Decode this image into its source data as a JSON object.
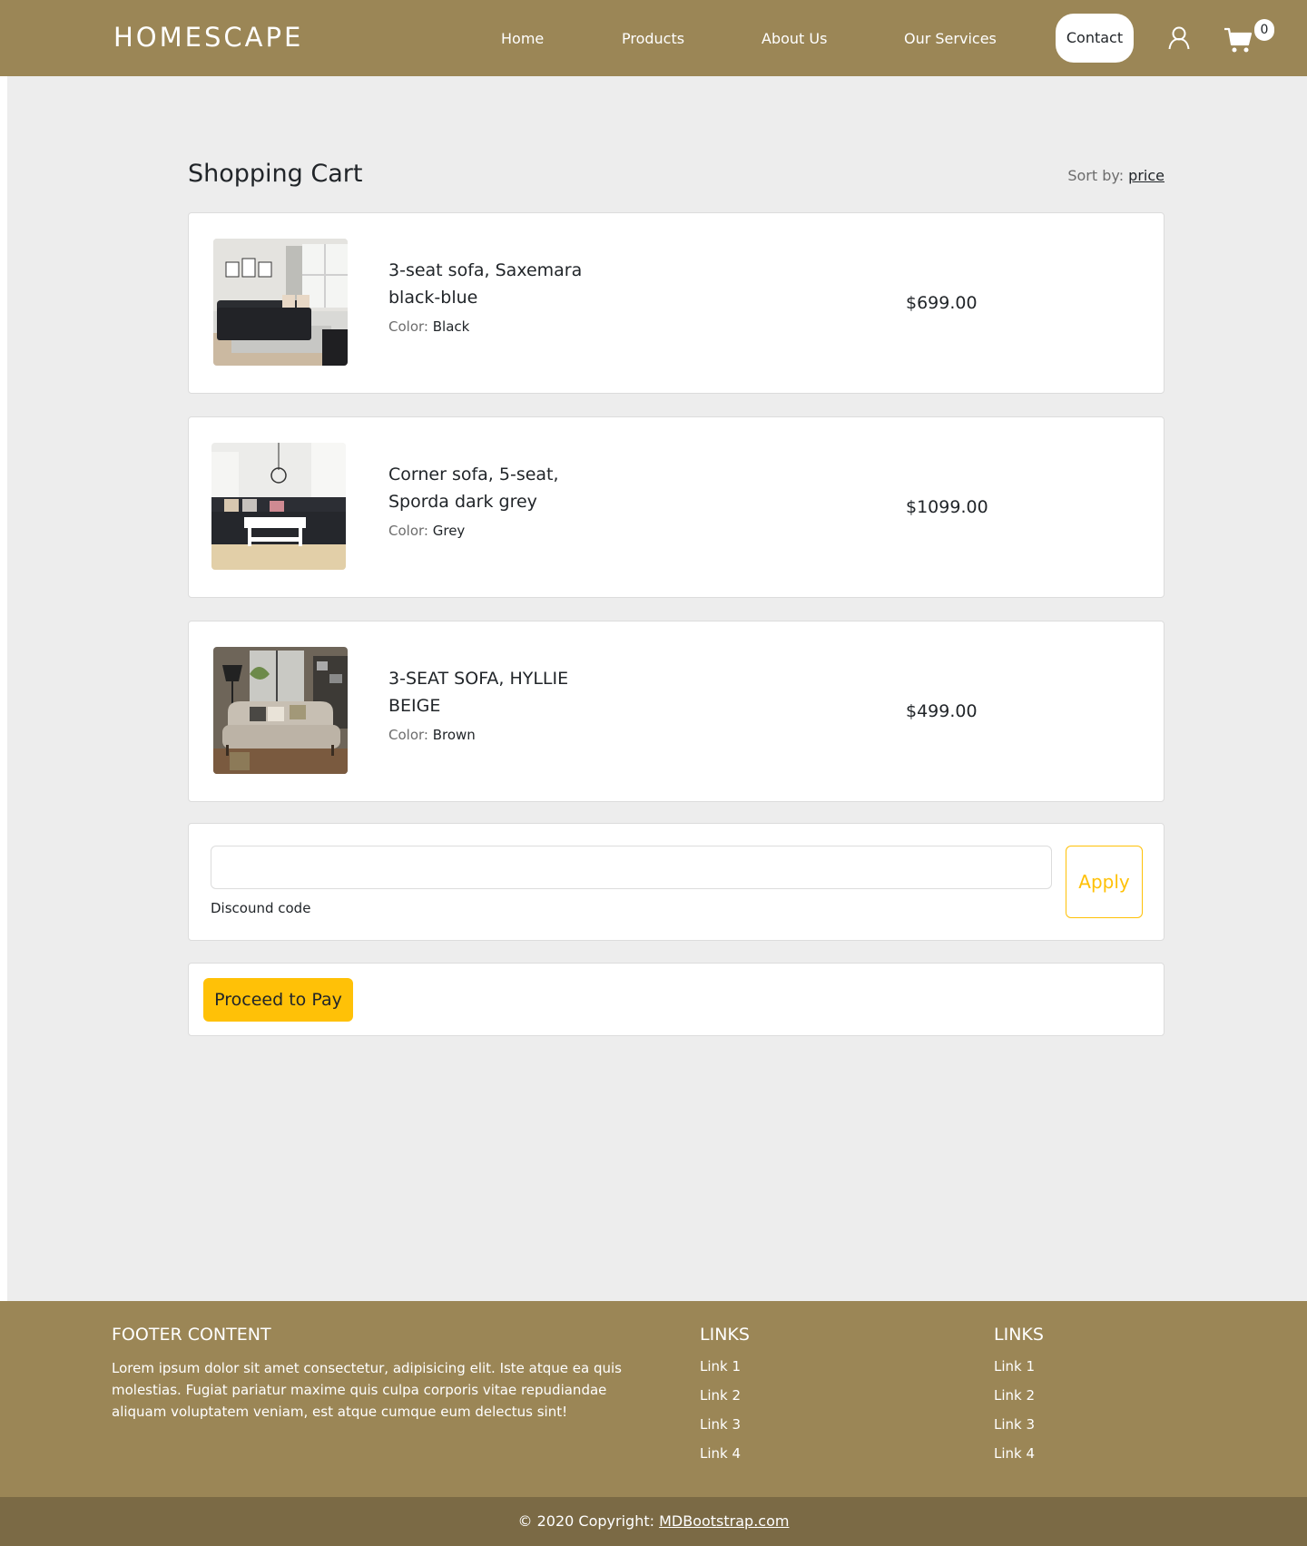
{
  "nav": {
    "brand": "HOMESCAPE",
    "links": [
      "Home",
      "Products",
      "About Us",
      "Our Services"
    ],
    "contact": "Contact",
    "cart_count": "0"
  },
  "cart": {
    "title": "Shopping Cart",
    "sort_label": "Sort by:",
    "sort_value": "price",
    "color_label": "Color:",
    "items": [
      {
        "name": "3-seat sofa, Saxemara black-blue",
        "color": "Black",
        "price": "$699.00"
      },
      {
        "name": "Corner sofa, 5-seat, Sporda dark grey",
        "color": "Grey",
        "price": "$1099.00"
      },
      {
        "name": "3-SEAT SOFA, HYLLIE BEIGE",
        "color": "Brown",
        "price": "$499.00"
      }
    ],
    "discount_value": "",
    "discount_label": "Discound code",
    "apply_label": "Apply",
    "pay_label": "Proceed to Pay"
  },
  "footer": {
    "heading": "FOOTER CONTENT",
    "text": "Lorem ipsum dolor sit amet consectetur, adipisicing elit. Iste atque ea quis molestias. Fugiat pariatur maxime quis culpa corporis vitae repudiandae aliquam voluptatem veniam, est atque cumque eum delectus sint!",
    "links_heading_1": "LINKS",
    "links_1": [
      "Link 1",
      "Link 2",
      "Link 3",
      "Link 4"
    ],
    "links_heading_2": "LINKS",
    "links_2": [
      "Link 1",
      "Link 2",
      "Link 3",
      "Link 4"
    ],
    "copyright_prefix": "© 2020 Copyright:",
    "copyright_link": "MDBootstrap.com"
  },
  "colors": {
    "header_footer": "#9b8656",
    "copyright_bar": "#7b6a45",
    "accent_yellow": "#ffc107",
    "page_bg": "#ededed"
  },
  "icons": [
    "user-icon",
    "shopping-cart-icon"
  ]
}
